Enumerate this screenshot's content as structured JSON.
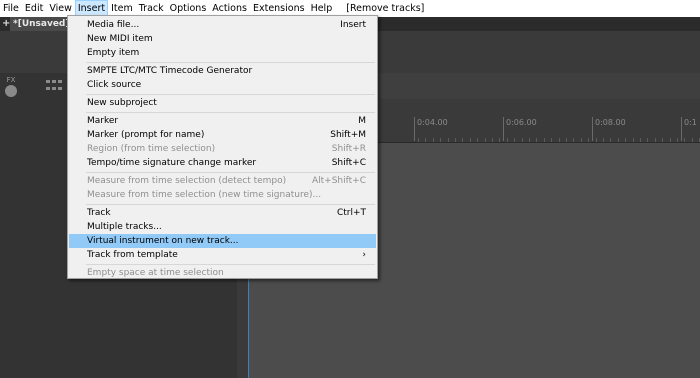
{
  "menubar": {
    "items": [
      "File",
      "Edit",
      "View",
      "Insert",
      "Item",
      "Track",
      "Options",
      "Actions",
      "Extensions",
      "Help"
    ],
    "action_label": "[Remove tracks]"
  },
  "tabs": {
    "add_label": "+",
    "project_tab": "*[Unsaved]"
  },
  "toolbar": {
    "fx_label": "FX"
  },
  "ruler": {
    "labels": [
      "0:04.00",
      "0:06.00",
      "0:08.00",
      "0:1"
    ]
  },
  "insert_menu": {
    "items": [
      {
        "label": "Media file...",
        "shortcut": "Insert"
      },
      {
        "label": "New MIDI item",
        "shortcut": ""
      },
      {
        "label": "Empty item",
        "shortcut": ""
      },
      {
        "label": "SMPTE LTC/MTC Timecode Generator",
        "shortcut": ""
      },
      {
        "label": "Click source",
        "shortcut": ""
      },
      {
        "label": "New subproject",
        "shortcut": ""
      },
      {
        "label": "Marker",
        "shortcut": "M"
      },
      {
        "label": "Marker (prompt for name)",
        "shortcut": "Shift+M"
      },
      {
        "label": "Region (from time selection)",
        "shortcut": "Shift+R"
      },
      {
        "label": "Tempo/time signature change marker",
        "shortcut": "Shift+C"
      },
      {
        "label": "Measure from time selection (detect tempo)",
        "shortcut": "Alt+Shift+C"
      },
      {
        "label": "Measure from time selection (new time signature)...",
        "shortcut": ""
      },
      {
        "label": "Track",
        "shortcut": "Ctrl+T"
      },
      {
        "label": "Multiple tracks...",
        "shortcut": ""
      },
      {
        "label": "Virtual instrument on new track...",
        "shortcut": ""
      },
      {
        "label": "Track from template",
        "shortcut": "›"
      },
      {
        "label": "Empty space at time selection",
        "shortcut": ""
      }
    ]
  }
}
